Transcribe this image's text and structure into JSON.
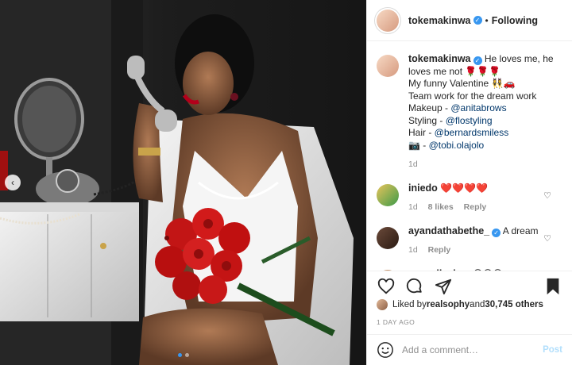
{
  "header": {
    "username": "tokemakinwa",
    "separator": "•",
    "follow_label": "Following"
  },
  "caption": {
    "username": "tokemakinwa",
    "line1": "He loves me, he loves me not 🌹🌹🌹",
    "line2": "My funny Valentine 👯‍♀️🚗",
    "line3": "Team work for the dream work",
    "makeup_label": "Makeup - ",
    "makeup_handle": "@anitabrows",
    "styling_label": "Styling - ",
    "styling_handle": "@flostyling",
    "hair_label": "Hair - ",
    "hair_handle": "@bernardsmiless",
    "camera_label": "📷 - ",
    "camera_handle": "@tobi.olajolo",
    "age": "1d"
  },
  "comments": [
    {
      "username": "iniedo",
      "text": "❤️❤️❤️❤️",
      "age": "1d",
      "likes": "8 likes",
      "reply": "Reply"
    },
    {
      "username": "ayandathabethe_",
      "text": "A dream",
      "age": "1d",
      "reply": "Reply"
    },
    {
      "username": "zynnellzuh",
      "text": "😍😍😍"
    }
  ],
  "likes": {
    "prefix": "Liked by ",
    "user": "realsophy",
    "middle": " and ",
    "count": "30,745 others"
  },
  "time_ago": "1 DAY AGO",
  "add_comment": {
    "placeholder": "Add a comment…",
    "post_label": "Post"
  },
  "carousel": {
    "slides": 2,
    "active": 0
  },
  "colors": {
    "accent": "#3897f0",
    "link": "#00376b",
    "muted": "#8e8e8e",
    "post_disabled": "#b2dffc"
  },
  "icons": [
    "chevron-left-icon",
    "heart-icon",
    "comment-icon",
    "share-icon",
    "bookmark-icon",
    "emoji-icon",
    "verified-icon"
  ]
}
